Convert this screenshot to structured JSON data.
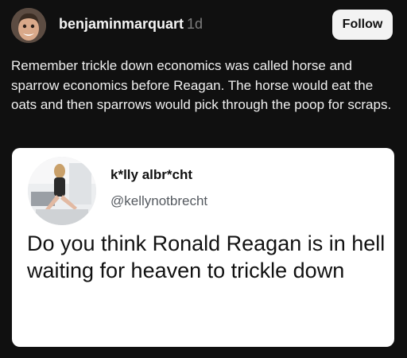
{
  "post": {
    "username": "benjaminmarquart",
    "timestamp": "1d",
    "follow_label": "Follow",
    "text": "Remember trickle down economics was called horse and sparrow economics before Reagan. The horse would eat the oats and then sparrows would pick through the poop for scraps."
  },
  "quoted": {
    "display_name": "k*lly albr*cht",
    "handle": "@kellynotbrecht",
    "text": "Do you think Ronald Reagan is in hell waiting for heaven to trickle down"
  },
  "colors": {
    "background": "#101010",
    "follow_button": "#f3f3f3",
    "card": "#ffffff",
    "timestamp": "#7d7d7d",
    "handle": "#555a60"
  }
}
